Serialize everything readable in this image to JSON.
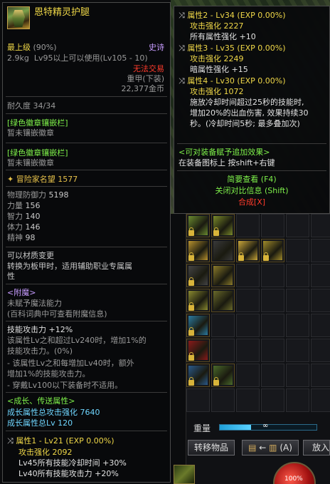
{
  "item": {
    "name": "恩特精灵护腿",
    "grade": "最上级",
    "grade_pct": "(90%)",
    "rarity": "史诗",
    "weight": "2.9kg",
    "level_req": "Lv95以上可以使用(Lv105 - 10)",
    "trade": "无法交易",
    "armor_type": "重甲(下装)",
    "price": "22,377金币",
    "durability": "耐久度 34/34",
    "emblem_slot_1": "[绿色徽章镶嵌栏]",
    "emblem_empty_1": "暂未镶嵌徽章",
    "emblem_slot_2": "[绿色徽章镶嵌栏]",
    "emblem_empty_2": "暂未镶嵌徽章",
    "adventure_fame": "冒险家名望 1577",
    "stats": [
      {
        "label": "物理防御力",
        "value": "5198"
      },
      {
        "label": "力量",
        "value": "156"
      },
      {
        "label": "智力",
        "value": "140"
      },
      {
        "label": "体力",
        "value": "146"
      },
      {
        "label": "精神",
        "value": "98"
      }
    ],
    "material_change": "可以材质变更",
    "material_desc_1": "转换为板甲时，适用辅助职业专属属",
    "material_desc_2": "性",
    "enchant_title": "<附魔>",
    "enchant_none": "未赋予魔法能力",
    "enchant_hint": "(百科词典中可查看附魔信息)",
    "skill_attack": "技能攻击力 +12%",
    "skill_desc_1": "该属性Lv之和超过Lv240时，增加1%的",
    "skill_desc_2": "技能攻击力。(0%)",
    "skill_desc_3": "- 该属性Lv之和每增加Lv40时，额外",
    "skill_desc_4": "增加1%的技能攻击力。",
    "skill_desc_5": "- 穿戴Lv100以下装备时不适用。",
    "growth_title": "<成长、传送属性>",
    "growth_total_atk": "成长属性总攻击强化 7640",
    "growth_total_lv": "成长属性总Lv 120",
    "attr1_title": "属性1 - Lv21 (EXP 0.00%)",
    "attr1_atk": "攻击强化 2092",
    "attr1_line2": "Lv45所有技能冷却时间 +30%",
    "attr1_line3": "Lv40所有技能攻击力 +20%"
  },
  "compare": {
    "attr2_title": "属性2 - Lv34 (EXP 0.00%)",
    "attr2_atk": "攻击强化 2227",
    "attr2_line2": "所有属性强化 +10",
    "attr3_title": "属性3 - Lv35 (EXP 0.00%)",
    "attr3_atk": "攻击强化 2249",
    "attr3_line2": "暗属性强化 +15",
    "attr4_title": "属性4 - Lv30 (EXP 0.00%)",
    "attr4_atk": "攻击强化 1072",
    "attr4_desc_1": "施放冷却时间超过25秒的技能时,",
    "attr4_desc_2": "增加20%的出血伤害, 效果持续30",
    "attr4_desc_3": "秒。(冷却时间5秒; 最多叠加次)",
    "extra_effect": "<可对装备赋予追加效果>",
    "extra_hint": "在装备图标上 按shift+右键",
    "quick_view": "简要查看 (F4)",
    "close_compare": "关闭对比信息 (Shift)",
    "compose": "合成[X]"
  },
  "inventory": {
    "weight_label": "重量",
    "weight_dots": "∞",
    "weight_fill": 0.32,
    "transfer_button": "转移物品",
    "sort_button_text": "(A)",
    "put_button": "放入",
    "orb_text": "100%"
  }
}
